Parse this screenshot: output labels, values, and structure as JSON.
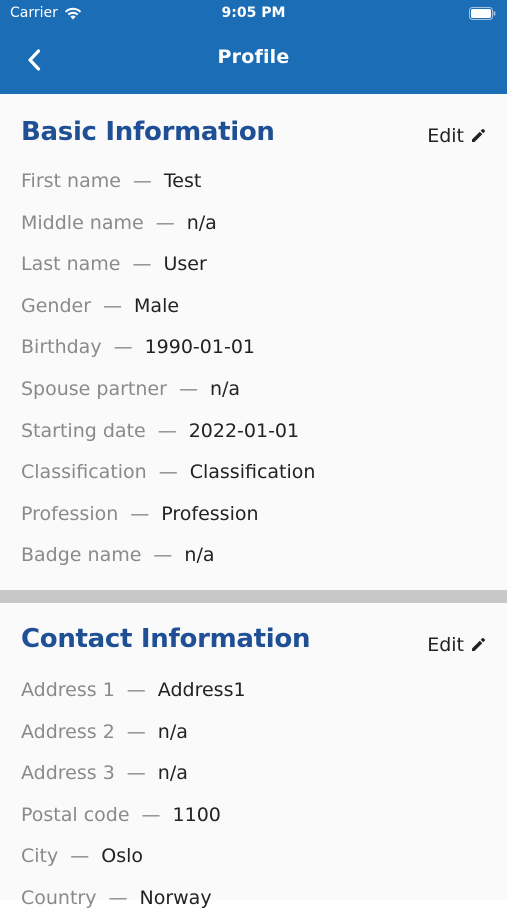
{
  "status_bar": {
    "carrier": "Carrier",
    "time": "9:05 PM"
  },
  "nav": {
    "title": "Profile"
  },
  "basic": {
    "title": "Basic Information",
    "edit_label": "Edit",
    "rows": [
      {
        "label": "First name",
        "value": "Test"
      },
      {
        "label": "Middle name",
        "value": "n/a"
      },
      {
        "label": "Last name",
        "value": "User"
      },
      {
        "label": "Gender",
        "value": "Male"
      },
      {
        "label": "Birthday",
        "value": "1990-01-01"
      },
      {
        "label": "Spouse partner",
        "value": "n/a"
      },
      {
        "label": "Starting date",
        "value": "2022-01-01"
      },
      {
        "label": "Classification",
        "value": "Classification"
      },
      {
        "label": "Profession",
        "value": "Profession"
      },
      {
        "label": "Badge name",
        "value": "n/a"
      }
    ]
  },
  "contact": {
    "title": "Contact Information",
    "edit_label": "Edit",
    "rows": [
      {
        "label": "Address 1",
        "value": "Address1"
      },
      {
        "label": "Address 2",
        "value": "n/a"
      },
      {
        "label": "Address 3",
        "value": "n/a"
      },
      {
        "label": "Postal code",
        "value": "1100"
      },
      {
        "label": "City",
        "value": "Oslo"
      },
      {
        "label": "Country",
        "value": "Norway"
      }
    ]
  },
  "separator": "—",
  "colors": {
    "header": "#1b6db5",
    "section_title": "#1f4f94",
    "label": "#8a8a8a",
    "value": "#222222",
    "divider": "#c8c8c8"
  },
  "icons": [
    "wifi-icon",
    "battery-icon",
    "back-chevron-icon",
    "pencil-icon"
  ]
}
